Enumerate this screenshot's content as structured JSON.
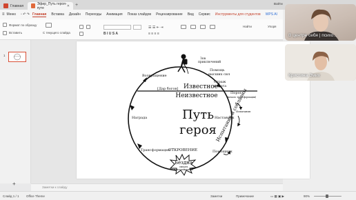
{
  "titlebar": {
    "home_tab": "Главная",
    "doc_tab": "Эфир_Путь героя-путе",
    "add_tab": "+",
    "window_login": "Войти"
  },
  "menubar": {
    "menu": "Меню",
    "items": [
      "Главная",
      "Вставка",
      "Дизайн",
      "Переходы",
      "Анимация",
      "Показ слайдов",
      "Рецензирование",
      "Вид",
      "Сервис",
      "Инструменты для студентов",
      "WPS AI"
    ]
  },
  "ribbon": {
    "format_painter": "Формат по образцу",
    "paste": "Вставить",
    "new_slide": "С текущего слайда",
    "find": "Найти",
    "arrange": "Упоря"
  },
  "thumbnail": {
    "number": "1"
  },
  "slide": {
    "known": "Известное",
    "unknown": "Неизвестное",
    "title_line1": "Путь",
    "title_line2": "героя",
    "call": "Зов",
    "call2": "приключений",
    "help": "Помощь",
    "help2": "высших сил",
    "guardian": "Страж",
    "guardian2": "порога",
    "threshold": "Порог",
    "threshold2": "(начало трансформации)",
    "challenges": "Испытания и соблазны",
    "challenge_small": "Испытания",
    "mentor": "Наставник",
    "helper": "Помощник",
    "revelation": "ОТКРОВЕНИЕ",
    "abyss": "Бездна",
    "abyss2": "смерть",
    "abyss3": "и возрождение",
    "transformation": "Трансформация",
    "reward": "Награда",
    "return": "Возвращение",
    "gift": "[Дар богов]"
  },
  "notes": {
    "placeholder": "Заметки к слайду"
  },
  "statusbar": {
    "slide": "Слайд 1 / 1",
    "theme": "Office Theme",
    "notes": "Заметки",
    "comments": "Примечание",
    "zoom": "90%"
  },
  "participants": [
    {
      "name": "В центре себя | психо..."
    },
    {
      "name": "Кристина Эмих"
    }
  ]
}
